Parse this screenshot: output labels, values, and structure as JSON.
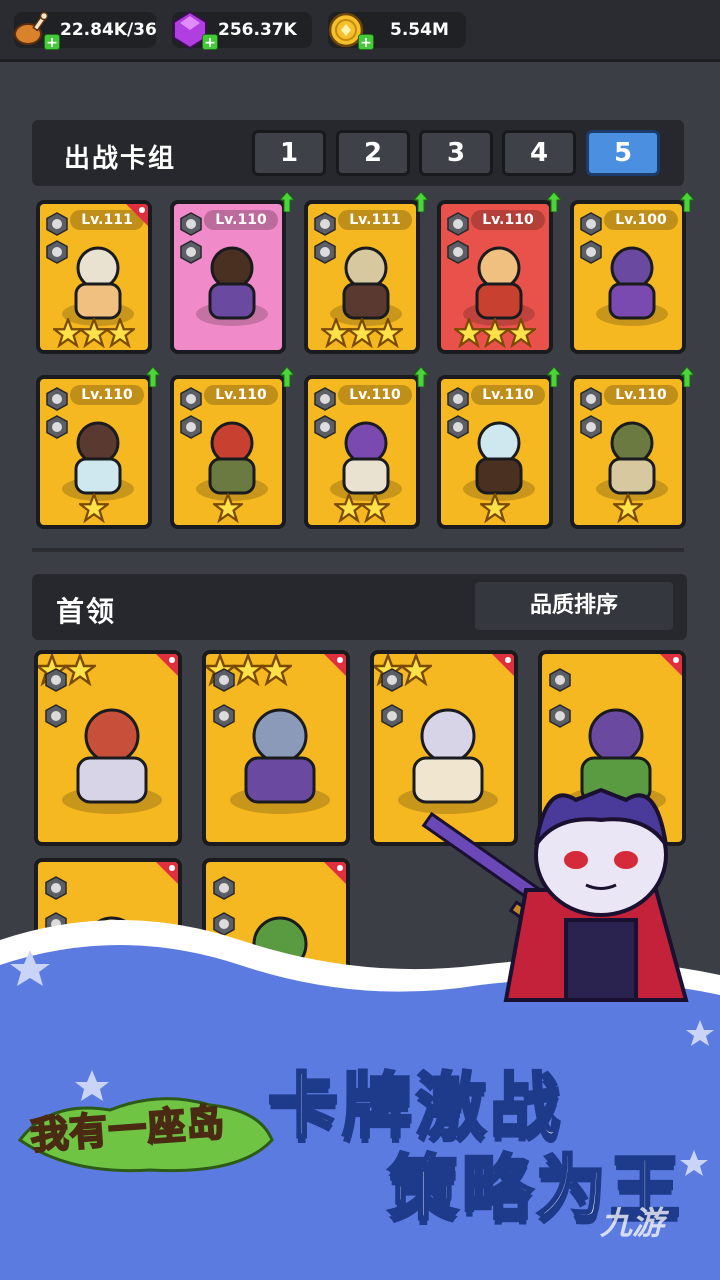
{
  "resources": [
    {
      "name": "food",
      "icon": "drumstick-icon",
      "value": "22.84K/36"
    },
    {
      "name": "gems",
      "icon": "purple-gem-icon",
      "value": "256.37K"
    },
    {
      "name": "coins",
      "icon": "gold-coin-icon",
      "value": "5.54M"
    }
  ],
  "deck": {
    "title": "出战卡组",
    "tabs": [
      "1",
      "2",
      "3",
      "4",
      "5"
    ],
    "active_tab": "5",
    "cards": [
      {
        "level": "Lv.111",
        "stars": 3,
        "color": "gold",
        "upgrade": false,
        "ribbon": true
      },
      {
        "level": "Lv.110",
        "stars": 0,
        "color": "pink",
        "upgrade": true,
        "ribbon": false
      },
      {
        "level": "Lv.111",
        "stars": 3,
        "color": "gold",
        "upgrade": true,
        "ribbon": false
      },
      {
        "level": "Lv.110",
        "stars": 3,
        "color": "red",
        "upgrade": true,
        "ribbon": false
      },
      {
        "level": "Lv.100",
        "stars": 0,
        "color": "gold",
        "upgrade": true,
        "ribbon": false
      },
      {
        "level": "Lv.110",
        "stars": 1,
        "color": "gold",
        "upgrade": true,
        "ribbon": false
      },
      {
        "level": "Lv.110",
        "stars": 1,
        "color": "gold",
        "upgrade": true,
        "ribbon": false
      },
      {
        "level": "Lv.110",
        "stars": 2,
        "color": "gold",
        "upgrade": true,
        "ribbon": false
      },
      {
        "level": "Lv.110",
        "stars": 1,
        "color": "gold",
        "upgrade": true,
        "ribbon": false
      },
      {
        "level": "Lv.110",
        "stars": 1,
        "color": "gold",
        "upgrade": true,
        "ribbon": false
      }
    ]
  },
  "bosses": {
    "title": "首领",
    "sort_label": "品质排序",
    "cards": [
      {
        "stars": 2
      },
      {
        "stars": 3
      },
      {
        "stars": 2
      },
      {
        "stars": 0
      },
      {
        "stars": 0
      },
      {
        "stars": 0
      }
    ]
  },
  "promo": {
    "game_logo": "我有一座岛",
    "slogan_line1": "卡牌激战",
    "slogan_line2": "策略为王",
    "watermark": "九游"
  },
  "colors": {
    "background": "#3b3e45",
    "active_tab": "#4b8fe0",
    "card_gold": "#f5b820",
    "card_pink": "#f08ac8",
    "card_red": "#e8524a",
    "banner_blue": "#5b7be0"
  }
}
